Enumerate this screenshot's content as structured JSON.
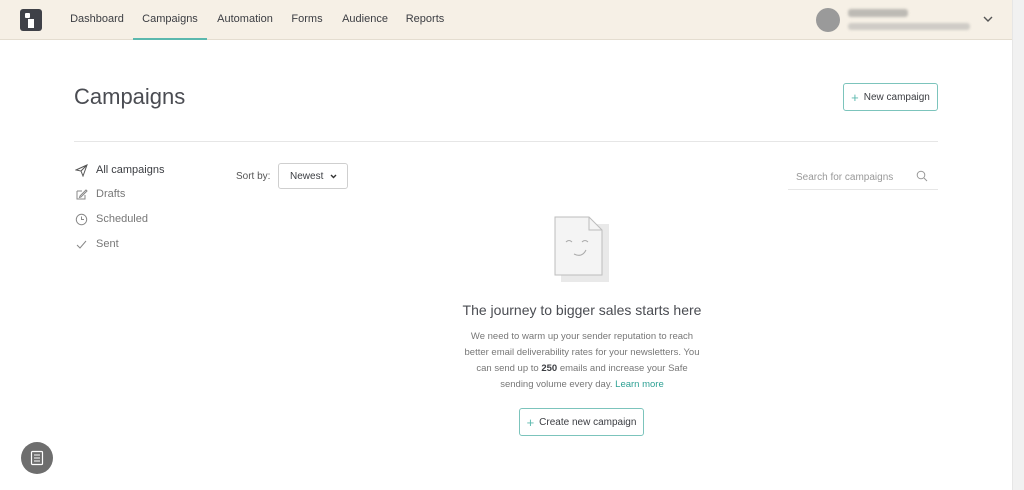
{
  "nav": {
    "items": [
      {
        "label": "Dashboard"
      },
      {
        "label": "Campaigns"
      },
      {
        "label": "Automation"
      },
      {
        "label": "Forms"
      },
      {
        "label": "Audience"
      },
      {
        "label": "Reports"
      }
    ],
    "active": "Campaigns"
  },
  "header": {
    "title": "Campaigns",
    "new_campaign_label": "New campaign"
  },
  "sidebar": {
    "items": [
      {
        "label": "All campaigns",
        "icon": "send-icon"
      },
      {
        "label": "Drafts",
        "icon": "edit-icon"
      },
      {
        "label": "Scheduled",
        "icon": "clock-icon"
      },
      {
        "label": "Sent",
        "icon": "check-icon"
      }
    ]
  },
  "sort": {
    "label": "Sort by:",
    "selected": "Newest"
  },
  "search": {
    "placeholder": "Search for campaigns"
  },
  "empty_state": {
    "title": "The journey to bigger sales starts here",
    "text_1": "We need to warm up your sender reputation to reach better email deliverability rates for your newsletters. You can send up to ",
    "emphasis": "250",
    "text_2": " emails and increase your Safe sending volume every day. ",
    "link": "Learn more",
    "button_label": "Create new campaign"
  },
  "colors": {
    "accent": "#5bb8ae",
    "topbar_bg": "#f6f0e6",
    "link": "#2ea194"
  }
}
